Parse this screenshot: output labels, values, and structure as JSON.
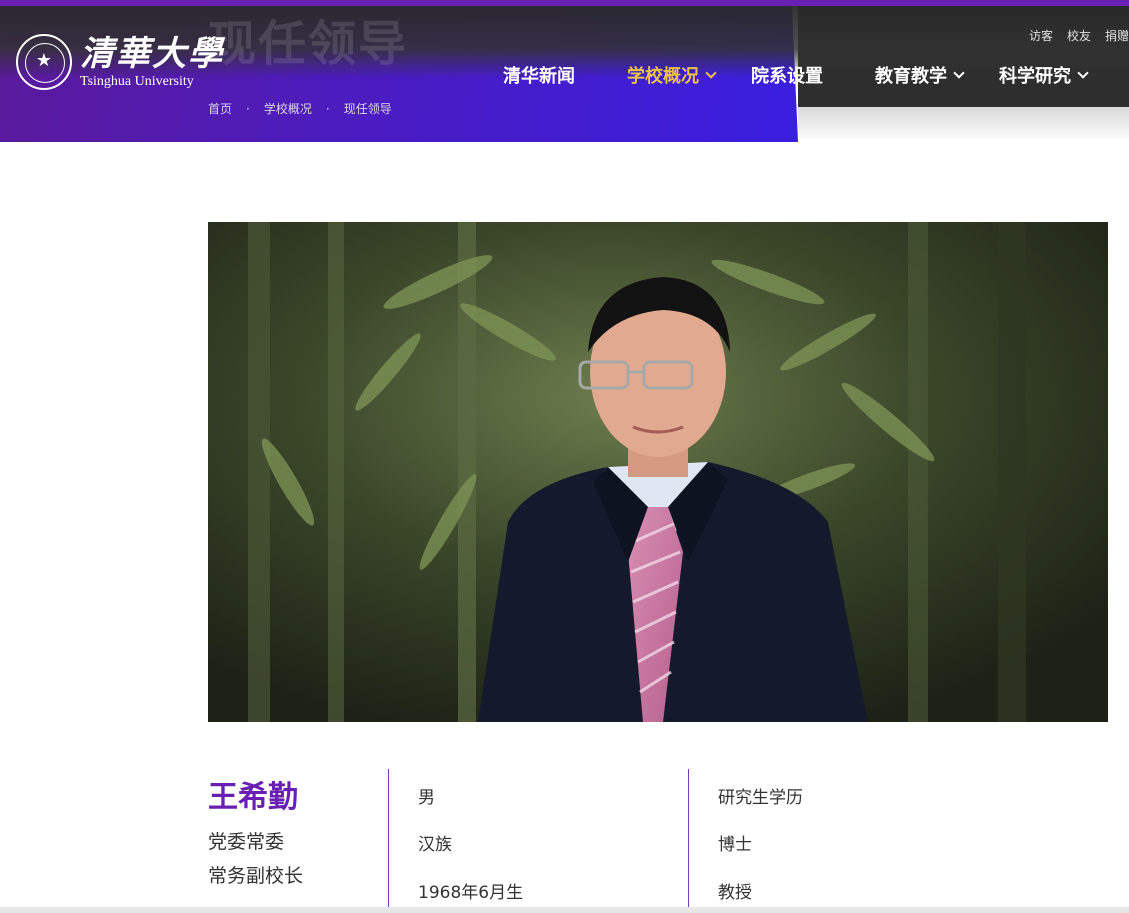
{
  "header": {
    "ghost_title": "现任领导",
    "logo_cn": "清華大學",
    "logo_en": "Tsinghua University",
    "utility_links": [
      "访客",
      "校友",
      "捐赠"
    ],
    "nav": [
      {
        "label": "清华新闻",
        "has_dropdown": false,
        "active": false
      },
      {
        "label": "学校概况",
        "has_dropdown": true,
        "active": true
      },
      {
        "label": "院系设置",
        "has_dropdown": false,
        "active": false
      },
      {
        "label": "教育教学",
        "has_dropdown": true,
        "active": false
      },
      {
        "label": "科学研究",
        "has_dropdown": true,
        "active": false
      }
    ],
    "breadcrumb": [
      "首页",
      "学校概况",
      "现任领导"
    ]
  },
  "colors": {
    "accent_purple": "#6a1fb3",
    "nav_active": "#e8c24a",
    "band_start": "#5a1a9a",
    "band_end": "#3a1fe0"
  },
  "profile": {
    "photo_alt": "王希勤",
    "name": "王希勤",
    "roles": [
      "党委常委",
      "常务副校长"
    ],
    "col2": [
      "男",
      "汉族",
      "1968年6月生"
    ],
    "col3": [
      "研究生学历",
      "博士",
      "教授"
    ]
  }
}
